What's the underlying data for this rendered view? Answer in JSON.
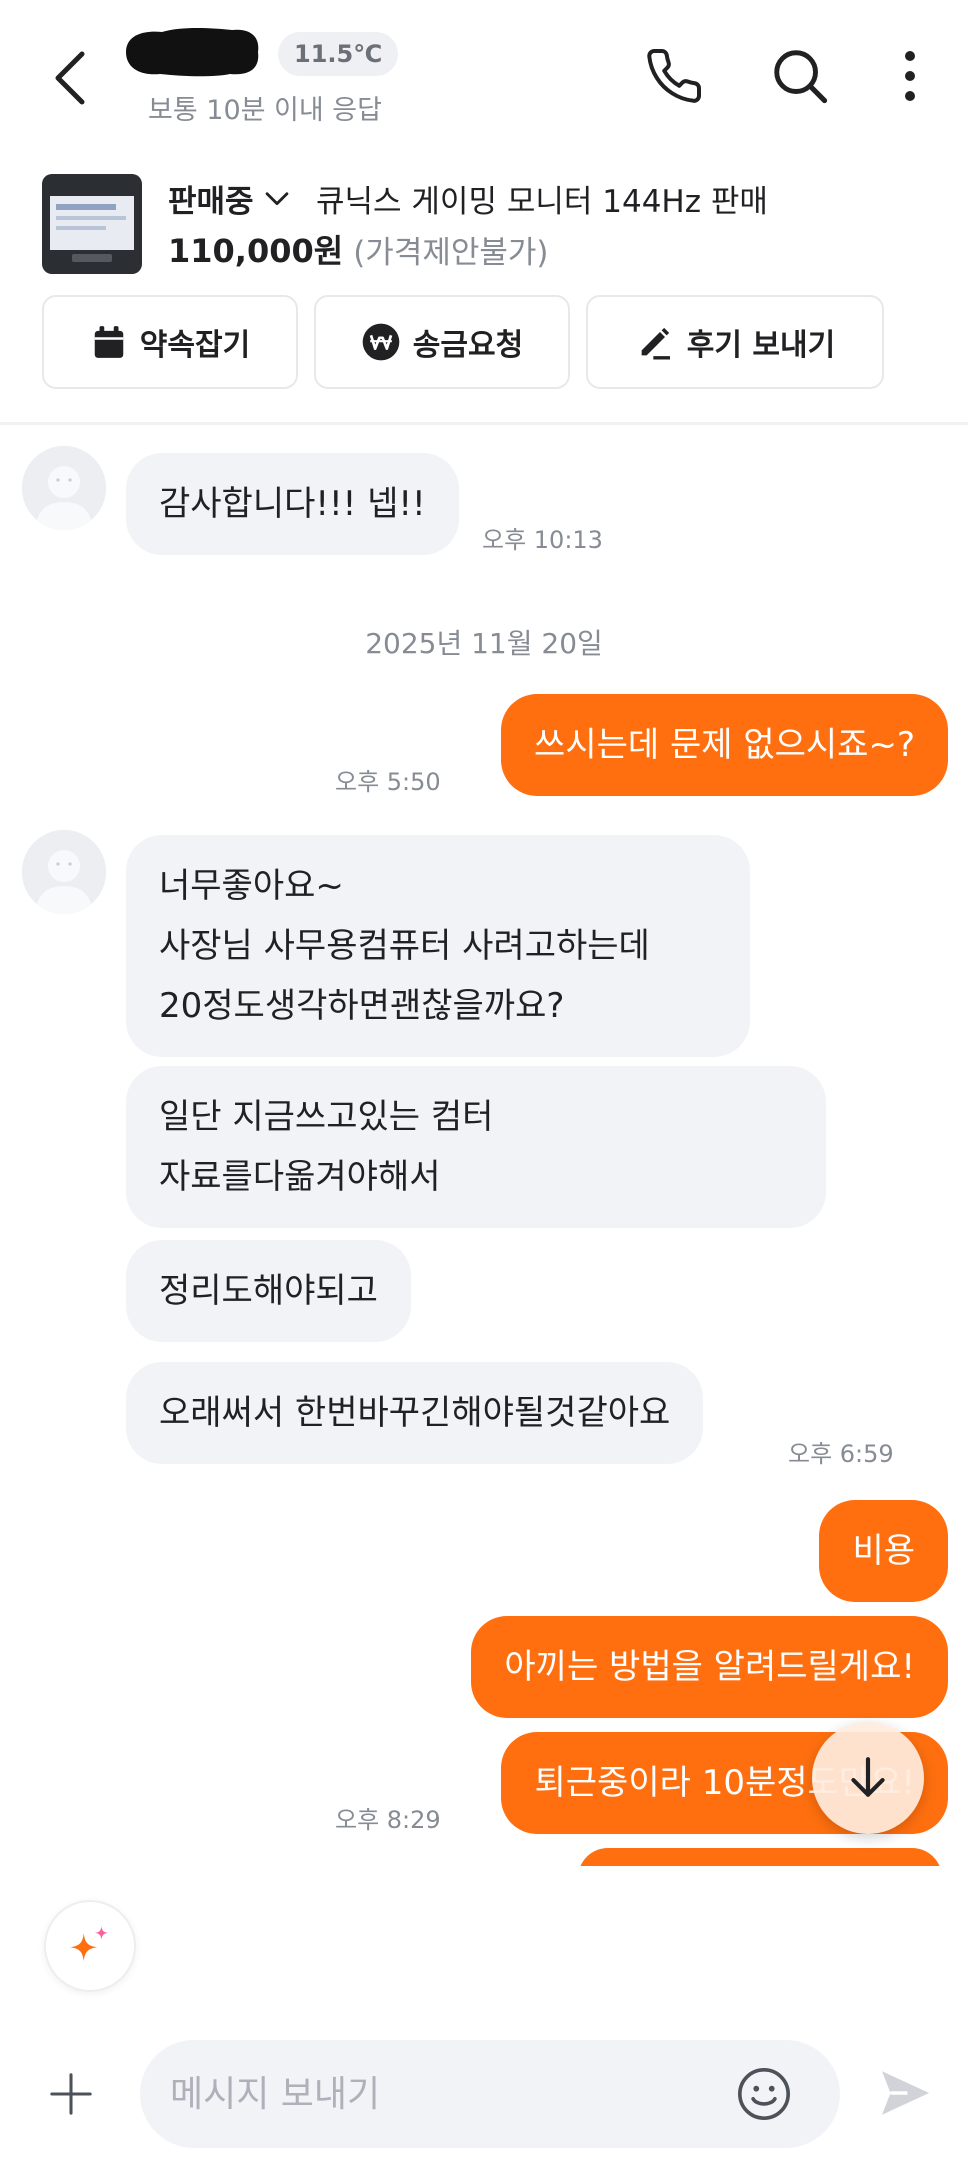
{
  "header": {
    "temperature": "11.5℃",
    "response_info": "보통 10분 이내 응답",
    "icons": [
      "back-arrow-icon",
      "phone-icon",
      "search-icon",
      "more-vertical-icon"
    ]
  },
  "product": {
    "status": "판매중",
    "title": "큐닉스 게이밍 모니터 144Hz 판매",
    "price": "110,000원",
    "price_note": "(가격제안불가)"
  },
  "actions": [
    {
      "label": "약속잡기",
      "icon": "calendar-icon"
    },
    {
      "label": "송금요청",
      "icon": "won-coin-icon"
    },
    {
      "label": "후기 보내기",
      "icon": "pencil-icon"
    }
  ],
  "chat": {
    "msg1": {
      "text": "감사합니다!!! 넵!!",
      "time": "오후 10:13"
    },
    "date_separator": "2025년 11월 20일",
    "msg2": {
      "text": "쓰시는데 문제 없으시죠~?",
      "time": "오후 5:50"
    },
    "msg3": {
      "line1": "너무좋아요~",
      "line2": "사장님 사무용컴퓨터 사려고하는데",
      "line3": "20정도생각하면괜찮을까요?"
    },
    "msg4": {
      "line1": "일단 지금쓰고있는 컴터",
      "line2": "자료를다옮겨야해서"
    },
    "msg5": {
      "text": "정리도해야되고"
    },
    "msg6": {
      "text": "오래써서 한번바꾸긴해야될것같아요",
      "time": "오후 6:59"
    },
    "msg7": {
      "text": "비용"
    },
    "msg8": {
      "text": "아끼는 방법을 알려드릴게요!"
    },
    "msg9": {
      "text": "퇴근중이라 10분정도만요!",
      "time": "오후 8:29"
    }
  },
  "input": {
    "placeholder": "메시지 보내기"
  },
  "colors": {
    "accent": "#ff6f0f",
    "incoming_bubble": "#f2f3f6",
    "muted_text": "#868b94"
  }
}
